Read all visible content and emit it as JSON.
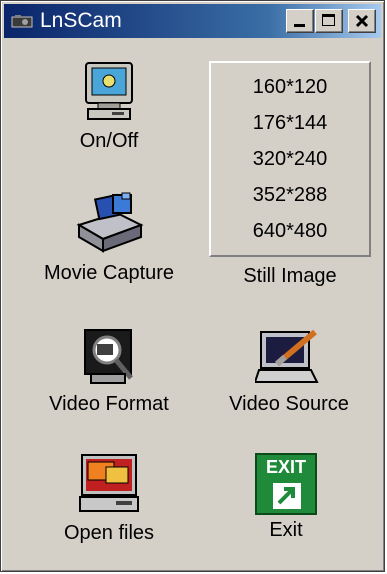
{
  "window": {
    "title": "LnSCam"
  },
  "buttons": {
    "on_off": "On/Off",
    "movie_capture": "Movie Capture",
    "still_image": "Still Image",
    "video_format": "Video Format",
    "video_source": "Video Source",
    "open_files": "Open files",
    "exit": "Exit",
    "exit_sign": "EXIT"
  },
  "resolutions": [
    "160*120",
    "176*144",
    "320*240",
    "352*288",
    "640*480"
  ],
  "colors": {
    "titlebar": "#0a246a",
    "face": "#d4d0c8",
    "exit_green": "#1f8a3a"
  }
}
